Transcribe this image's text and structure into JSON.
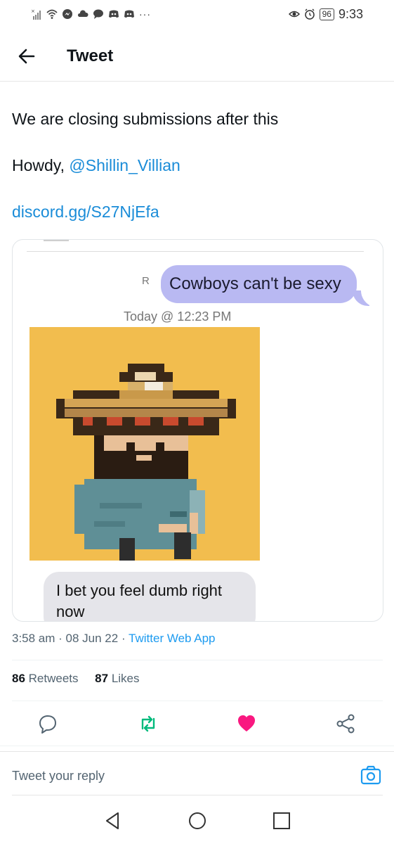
{
  "status_bar": {
    "time": "9:33",
    "battery": "96",
    "icons": [
      "signal-icon",
      "wifi-icon",
      "messenger-icon",
      "cloud-icon",
      "chat-icon",
      "discord-icon",
      "discord-icon",
      "more-dots-icon",
      "eye-icon",
      "alarm-icon",
      "battery-icon"
    ],
    "dots": "···"
  },
  "header": {
    "title": "Tweet",
    "back_icon": "arrow-left-icon"
  },
  "tweet": {
    "line1": "We are closing submissions after this",
    "line2_prefix": "Howdy, ",
    "mention": "@Shillin_Villian",
    "link": "discord.gg/S27NjEfa"
  },
  "media": {
    "sent_message": "Cowboys can't be sexy",
    "chat_timestamp": "Today @ 12:23 PM",
    "received_message": "I bet you feel dumb right now",
    "sender_mark": "R"
  },
  "meta": {
    "time": "3:58 am",
    "date": "08 Jun 22",
    "source": "Twitter Web App",
    "separator": " · "
  },
  "stats": {
    "retweets_count": "86",
    "retweets_label": "Retweets",
    "likes_count": "87",
    "likes_label": "Likes"
  },
  "actions": {
    "reply_icon": "reply-icon",
    "retweet_icon": "retweet-icon",
    "like_icon": "heart-icon",
    "share_icon": "share-icon",
    "retweet_color": "#00ba7c",
    "like_color": "#f91880"
  },
  "reply": {
    "placeholder": "Tweet your reply",
    "camera_icon": "camera-icon",
    "camera_color": "#1d9bf0"
  },
  "nav": {
    "back_icon": "nav-back-icon",
    "home_icon": "nav-home-icon",
    "recents_icon": "nav-recents-icon"
  }
}
